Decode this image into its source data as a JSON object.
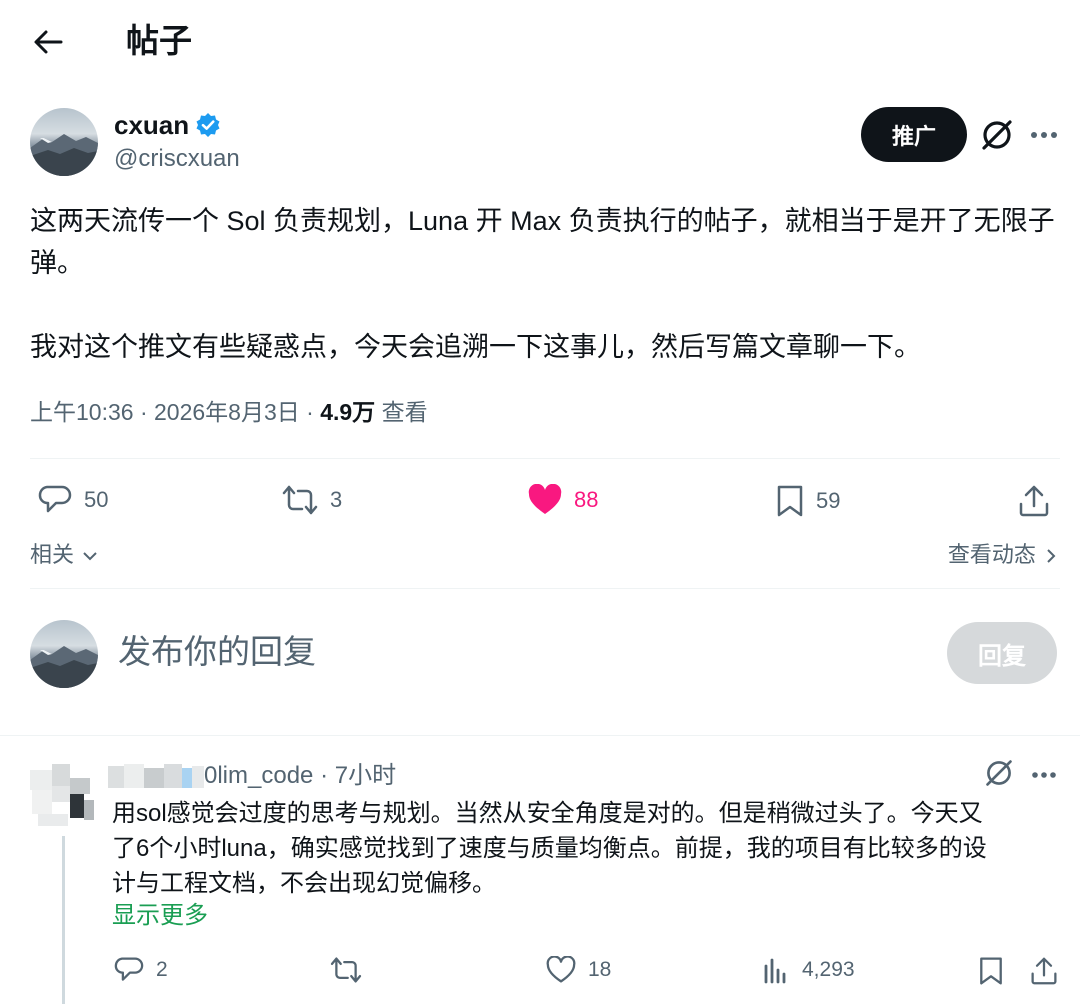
{
  "header": {
    "title": "帖子"
  },
  "post": {
    "author_name": "cxuan",
    "author_handle": "@criscxuan",
    "promote_label": "推广",
    "paragraphs": [
      "这两天流传一个 Sol 负责规划，Luna 开 Max 负责执行的帖子，就相当于是开了无限子弹。",
      "我对这个推文有些疑惑点，今天会追溯一下这事儿，然后写篇文章聊一下。"
    ],
    "timestamp": "上午10:36 · 2026年8月3日 · ",
    "views_count": "4.9万",
    "views_label": "查看",
    "replies": "50",
    "reposts": "3",
    "likes": "88",
    "bookmarks": "59",
    "liked": true,
    "like_color": "#f91880"
  },
  "related": {
    "label": "相关",
    "activity_label": "查看动态"
  },
  "composer": {
    "placeholder": "发布你的回复",
    "reply_button": "回复"
  },
  "reply": {
    "handle_time": "0lim_code · 7小时",
    "lines": [
      "用sol感觉会过度的思考与规划。当然从安全角度是对的。但是稍微过头了。今天又",
      "了6个小时luna，确实感觉找到了速度与质量均衡点。前提，我的项目有比较多的设",
      "计与工程文档，不会出现幻觉偏移。"
    ],
    "show_more": "显示更多",
    "replies": "2",
    "reposts": "",
    "likes": "18",
    "views": "4,293"
  }
}
